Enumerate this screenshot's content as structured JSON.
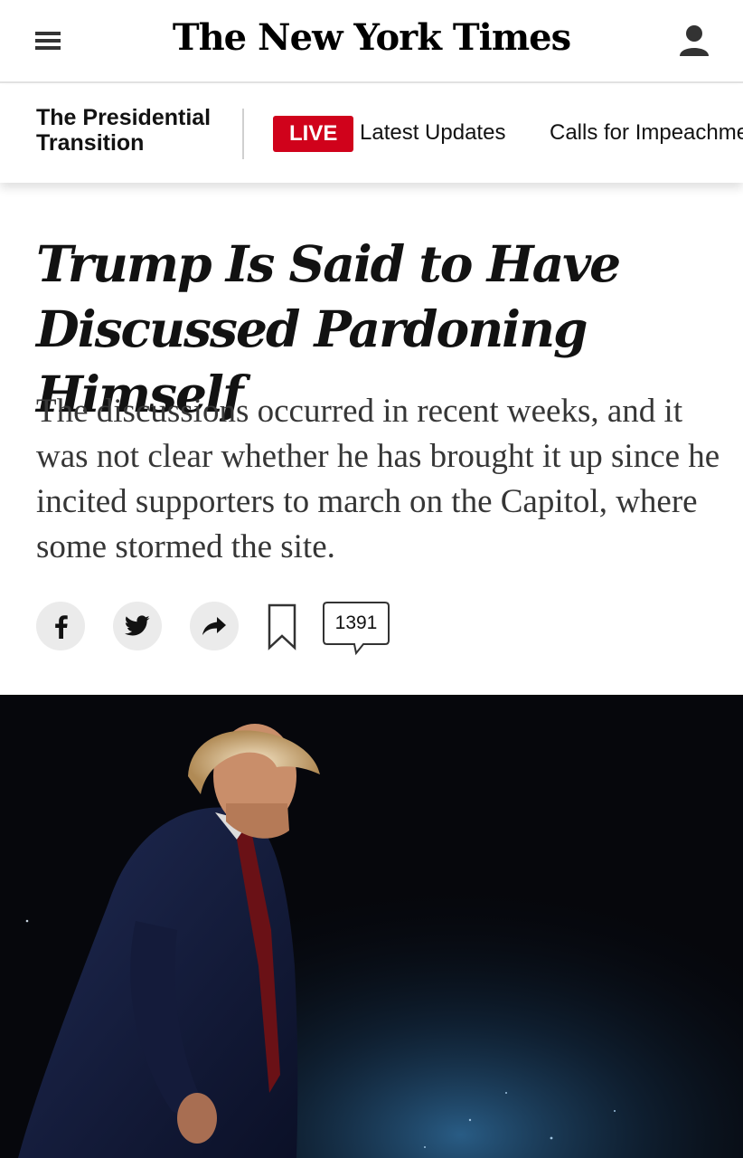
{
  "masthead": {
    "logo_text": "The New York Times",
    "menu_icon": "hamburger-menu-icon",
    "account_icon": "user-account-icon"
  },
  "section_bar": {
    "section_title": "The Presidential Transition",
    "live_label": "LIVE",
    "links": [
      "Latest Updates",
      "Calls for Impeachment"
    ]
  },
  "article": {
    "headline": "Trump Is Said to Have Discussed Pardoning Himself",
    "summary": "The discussions occurred in recent weeks, and it was not clear whether he has brought it up since he incited supporters to march on the Capitol, where some stormed the site."
  },
  "share_tools": {
    "facebook_icon": "facebook-icon",
    "twitter_icon": "twitter-icon",
    "share_icon": "share-arrow-icon",
    "bookmark_icon": "bookmark-icon",
    "comment_count": "1391"
  },
  "colors": {
    "live_red": "#d0021b",
    "text": "#121212",
    "summary_text": "#363636",
    "icon_bg": "#ebebeb"
  }
}
